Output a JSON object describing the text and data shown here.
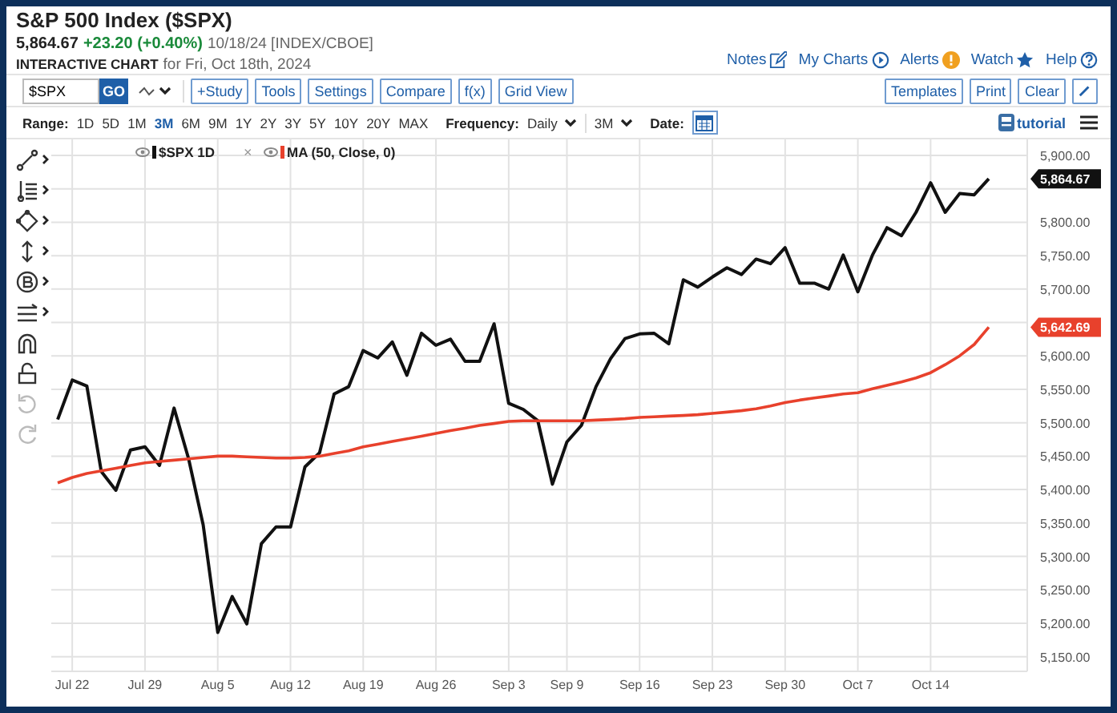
{
  "header": {
    "title": "S&P 500 Index ($SPX)",
    "price": "5,864.67",
    "change": "+23.20 (+0.40%)",
    "meta": "10/18/24 [INDEX/CBOE]",
    "chart_label": "INTERACTIVE CHART",
    "chart_date": "for Fri, Oct 18th, 2024"
  },
  "links": [
    {
      "label": "Notes",
      "kind": "notes"
    },
    {
      "label": "My Charts",
      "kind": "charts"
    },
    {
      "label": "Alerts",
      "kind": "alerts"
    },
    {
      "label": "Watch",
      "kind": "watch"
    },
    {
      "label": "Help",
      "kind": "help"
    }
  ],
  "symbol": {
    "value": "$SPX",
    "go": "GO"
  },
  "buttons": [
    "+Study",
    "Tools",
    "Settings",
    "Compare",
    "f(x)",
    "Grid View"
  ],
  "right_buttons": [
    "Templates",
    "Print",
    "Clear"
  ],
  "range": {
    "label": "Range:",
    "options": [
      {
        "label": "1D",
        "selected": false
      },
      {
        "label": "5D",
        "selected": false
      },
      {
        "label": "1M",
        "selected": false
      },
      {
        "label": "3M",
        "selected": true
      },
      {
        "label": "6M",
        "selected": false
      },
      {
        "label": "9M",
        "selected": false
      },
      {
        "label": "1Y",
        "selected": false
      },
      {
        "label": "2Y",
        "selected": false
      },
      {
        "label": "3Y",
        "selected": false
      },
      {
        "label": "5Y",
        "selected": false
      },
      {
        "label": "10Y",
        "selected": false
      },
      {
        "label": "20Y",
        "selected": false
      },
      {
        "label": "MAX",
        "selected": false
      }
    ]
  },
  "frequency": {
    "label": "Frequency:",
    "value": "Daily"
  },
  "period": {
    "value": "3M"
  },
  "date": {
    "label": "Date:"
  },
  "tutorial": "tutorial",
  "tools": [
    {
      "kind": "line",
      "disabled": false
    },
    {
      "kind": "fib",
      "disabled": false
    },
    {
      "kind": "shape",
      "disabled": false
    },
    {
      "kind": "measure",
      "disabled": false
    },
    {
      "kind": "pattern",
      "disabled": false
    },
    {
      "kind": "arrows",
      "disabled": false
    },
    {
      "kind": "magnet",
      "disabled": false
    },
    {
      "kind": "lock",
      "disabled": false
    },
    {
      "kind": "undo",
      "disabled": true
    },
    {
      "kind": "redo",
      "disabled": true
    }
  ],
  "legend": [
    {
      "removable": false
    },
    {
      "removable": true,
      "close": "×"
    }
  ],
  "price_tags": [
    "5,864.67",
    "5,642.69"
  ],
  "chart_data": {
    "type": "line",
    "grid": true,
    "legend": "top-left",
    "ylim": [
      5128,
      5924
    ],
    "yticks": [
      {
        "value": 5150,
        "label": "5,150.00"
      },
      {
        "value": 5200,
        "label": "5,200.00"
      },
      {
        "value": 5250,
        "label": "5,250.00"
      },
      {
        "value": 5300,
        "label": "5,300.00"
      },
      {
        "value": 5350,
        "label": "5,350.00"
      },
      {
        "value": 5400,
        "label": "5,400.00"
      },
      {
        "value": 5450,
        "label": "5,450.00"
      },
      {
        "value": 5500,
        "label": "5,500.00"
      },
      {
        "value": 5550,
        "label": "5,550.00"
      },
      {
        "value": 5600,
        "label": "5,600.00"
      },
      {
        "value": 5700,
        "label": "5,700.00"
      },
      {
        "value": 5750,
        "label": "5,750.00"
      },
      {
        "value": 5800,
        "label": "5,800.00"
      },
      {
        "value": 5900,
        "label": "5,900.00"
      }
    ],
    "categories": [
      null,
      "Jul 22",
      null,
      null,
      null,
      null,
      "Jul 29",
      null,
      null,
      null,
      null,
      "Aug 5",
      null,
      null,
      null,
      null,
      "Aug 12",
      null,
      null,
      null,
      null,
      "Aug 19",
      null,
      null,
      null,
      null,
      "Aug 26",
      null,
      null,
      null,
      null,
      "Sep 3",
      null,
      null,
      null,
      "Sep 9",
      null,
      null,
      null,
      null,
      "Sep 16",
      null,
      null,
      null,
      null,
      "Sep 23",
      null,
      null,
      null,
      null,
      "Sep 30",
      null,
      null,
      null,
      null,
      "Oct 7",
      null,
      null,
      null,
      null,
      "Oct 14",
      null,
      null,
      null,
      null
    ],
    "series": [
      {
        "name": "$SPX 1D",
        "color": "#111111",
        "values": [
          5505,
          5564,
          5555,
          5427,
          5399,
          5459,
          5464,
          5436,
          5522,
          5446,
          5347,
          5186,
          5240,
          5199,
          5319,
          5344,
          5344,
          5434,
          5455,
          5543,
          5554,
          5608,
          5597,
          5621,
          5571,
          5634,
          5616,
          5625,
          5592,
          5592,
          5648,
          5529,
          5520,
          5503,
          5408,
          5471,
          5496,
          5554,
          5596,
          5626,
          5633,
          5634,
          5618,
          5714,
          5703,
          5718,
          5732,
          5722,
          5745,
          5738,
          5762,
          5709,
          5709,
          5700,
          5751,
          5696,
          5751,
          5792,
          5780,
          5815,
          5859,
          5815,
          5843,
          5841,
          5865
        ]
      },
      {
        "name": "MA (50, Close, 0)",
        "color": "#e8412c",
        "values": [
          5410,
          5418,
          5424,
          5428,
          5432,
          5436,
          5440,
          5442,
          5444,
          5446,
          5448,
          5450,
          5450,
          5449,
          5448,
          5447,
          5447,
          5448,
          5450,
          5454,
          5458,
          5464,
          5468,
          5472,
          5476,
          5480,
          5484,
          5488,
          5492,
          5496,
          5499,
          5502,
          5503,
          5503,
          5503,
          5503,
          5503,
          5504,
          5505,
          5506,
          5508,
          5509,
          5510,
          5511,
          5512,
          5514,
          5516,
          5518,
          5521,
          5525,
          5530,
          5534,
          5537,
          5540,
          5543,
          5545,
          5551,
          5556,
          5561,
          5567,
          5575,
          5587,
          5600,
          5617,
          5643
        ]
      }
    ]
  }
}
